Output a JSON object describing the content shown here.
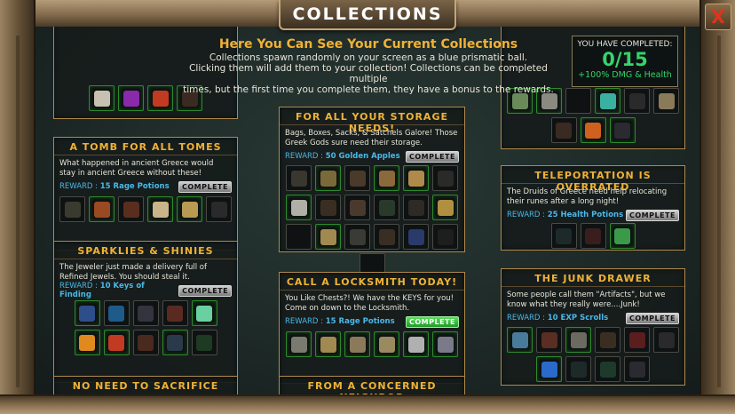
{
  "window": {
    "title": "COLLECTIONS",
    "close_label": "X"
  },
  "header": {
    "title": "Here You Can See Your Current Collections",
    "line1": "Collections spawn randomly on your screen as a blue prismatic ball.",
    "line2": "Clicking them will add them to your collection! Collections can be completed multiple",
    "line3": "times, but the first time you complete them, they have a bonus to the rewards."
  },
  "completed": {
    "label": "YOU HAVE COMPLETED:",
    "count": "0/15",
    "bonus": "+100% DMG & Health"
  },
  "colors": {
    "accent": "#f0b235",
    "reward": "#4ab8e8",
    "complete_active": "#37d36a",
    "border": "#b0894d"
  },
  "reward_prefix": "REWARD :",
  "collections": [
    {
      "title": "A TOMB FOR ALL TOMES",
      "desc": "What happened in ancient Greece would stay in ancient Greece without these!",
      "reward": "15 Rage Potions",
      "button": "COMPLETE",
      "items": [
        "dark-book",
        "red-book",
        "brown-book",
        "open-book",
        "scroll-book",
        "black-book"
      ]
    },
    {
      "title": "SPARKLIES & SHINIES",
      "desc": "The Jeweler just made a delivery full of Refined Jewels. You should steal it.",
      "reward": "10 Keys of Finding",
      "button": "COMPLETE",
      "items": [
        "blue-feather",
        "blue-gem",
        "dark-orb",
        "red-stone",
        "prism-gem",
        "fire-gem",
        "red-orb",
        "brown-orb",
        "black-gem",
        "green-orb"
      ]
    },
    {
      "title": "NO NEED TO SACRIFICE"
    },
    {
      "title": "FOR ALL YOUR STORAGE NEEDS!",
      "desc": "Bags, Boxes, Sacks, & Satchels Galore! Those Greek Gods sure need their storage.",
      "reward": "50 Golden Apples",
      "button": "COMPLETE",
      "items": [
        "sack",
        "satchel",
        "pack",
        "horn-bag",
        "gold-bag",
        "dark-bag",
        "stone-box",
        "crate",
        "brown-box",
        "green-sack",
        "dark-box",
        "gold-sack",
        "empty",
        "gold-crate",
        "cloth-bag",
        "scroll-bag",
        "blue-bag",
        "black-pot",
        "empty"
      ]
    },
    {
      "title": "CALL A LOCKSMITH TODAY!",
      "desc": "You Like Chests?! We have the KEYS for you! Come on down to the Locksmith.",
      "reward": "15 Rage Potions",
      "button": "COMPLETE",
      "items": [
        "shovel",
        "ring-key",
        "ornate-key",
        "gear-key",
        "silver-key",
        "lock-key"
      ]
    },
    {
      "title": "FROM A CONCERNED NEIGHBOR"
    },
    {
      "title": "TELEPORTATION IS OVERRATED",
      "desc": "The Druids of Greece need help relocating their runes after a long night!",
      "reward": "25 Health Potions",
      "button": "COMPLETE",
      "items": [
        "dark-rune",
        "red-rune",
        "green-rune"
      ]
    },
    {
      "title": "THE JUNK DRAWER",
      "desc": "Some people call them \"Artifacts\", but we know what they really were....Junk!",
      "reward": "10 EXP Scrolls",
      "button": "COMPLETE",
      "items": [
        "plate",
        "wood-disk",
        "helmet",
        "chest",
        "red-chest",
        "dark-chest",
        "blue-sword",
        "dark-shard",
        "green-shard",
        "dark-tablet"
      ]
    }
  ],
  "partial_top_left_items": [
    "skull",
    "purple-pot",
    "red-potion",
    "dark-item"
  ],
  "partial_top_right_items": [
    "tunic",
    "ring",
    "empty",
    "wings",
    "dark-armor",
    "vest",
    "boots",
    "orange-armor",
    "dark-boots"
  ]
}
